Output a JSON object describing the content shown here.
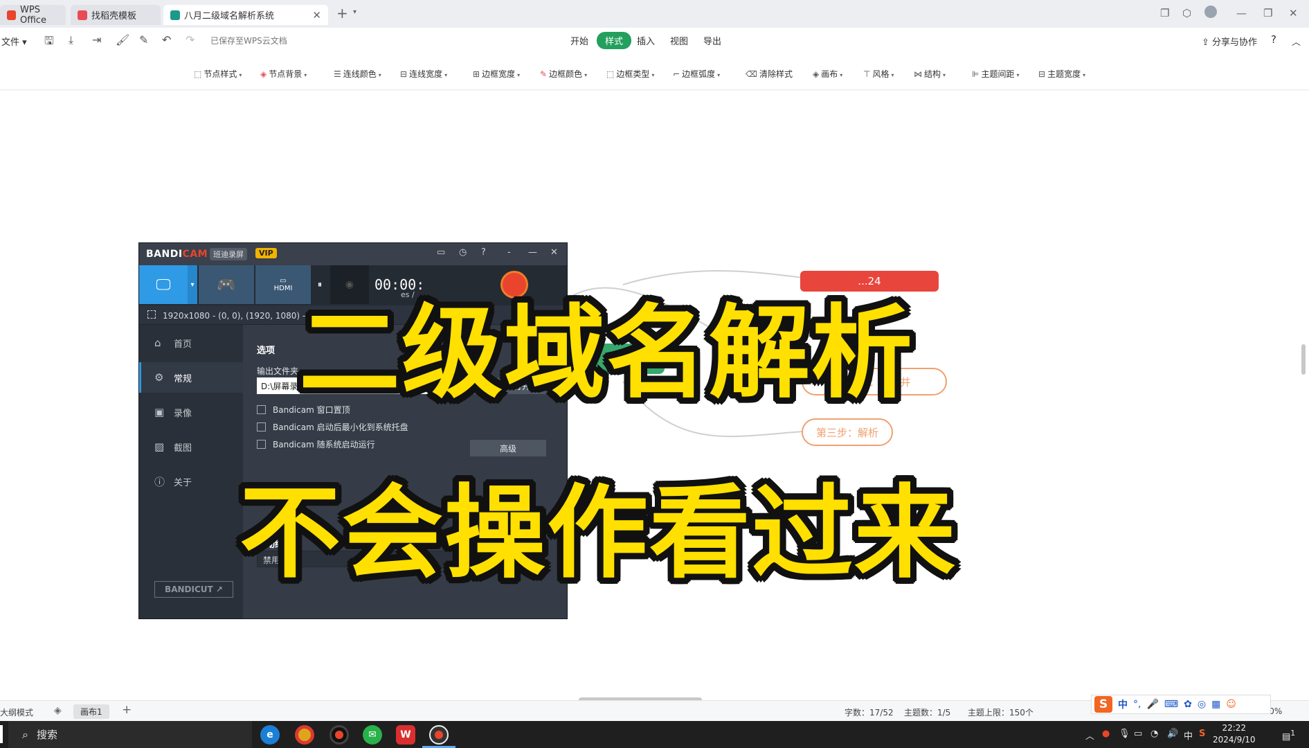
{
  "titlebar": {
    "tabs": [
      {
        "label": "WPS Office",
        "active": false
      },
      {
        "label": "找稻壳模板",
        "active": false
      },
      {
        "label": "八月二级域名解析系统",
        "active": true
      }
    ],
    "new_tab": "+",
    "window_controls": [
      "minimize",
      "restore",
      "close"
    ]
  },
  "menubar": {
    "file_label": "文件",
    "saved_status": "已保存至WPS云文档",
    "tabs": [
      "开始",
      "样式",
      "插入",
      "视图",
      "导出"
    ],
    "active_tab": "样式",
    "share_label": "分享与协作",
    "help": "?"
  },
  "stylebar": {
    "items": [
      "节点样式",
      "节点背景",
      "连线颜色",
      "连线宽度",
      "边框宽度",
      "边框颜色",
      "边框类型",
      "边框弧度",
      "清除样式",
      "画布",
      "风格",
      "结构",
      "主题间距",
      "主题宽度"
    ]
  },
  "mindmap": {
    "nodes": [
      {
        "label": "第二步：选择并",
        "color": "#f0a070"
      },
      {
        "label": "第三步：解析",
        "color": "#f0a070"
      }
    ],
    "partial_labels": [
      "...24",
      "口"
    ]
  },
  "bandicam": {
    "brand_a": "BANDI",
    "brand_b": "CAM",
    "brand_cn": "班迪录屏",
    "vip": "VIP",
    "timer": "00:00:",
    "size_text": "es /",
    "hdmi": "HDMI",
    "region": "1920x1080 - (0, 0), (1920, 1080) - 显示器 1",
    "nav": [
      {
        "label": "首页",
        "icon": "home-icon"
      },
      {
        "label": "常规",
        "icon": "gear-icon"
      },
      {
        "label": "录像",
        "icon": "video-icon"
      },
      {
        "label": "截图",
        "icon": "image-icon"
      },
      {
        "label": "关于",
        "icon": "info-icon"
      }
    ],
    "active_nav": "常规",
    "bandicut": "BANDICUT",
    "section_options": "选项",
    "output_folder_label": "输出文件夹",
    "output_path": "D:\\屏幕录制\\视频",
    "browse_btn": "...",
    "open_btn": "打开",
    "checks": [
      {
        "label": "Bandicam 窗口置顶",
        "checked": false
      },
      {
        "label": "Bandicam 启动后最小化到系统托盘",
        "checked": false
      },
      {
        "label": "Bandicam 随系统启动运行",
        "checked": false
      }
    ],
    "advanced_btn": "高级",
    "timer_section": "定时录",
    "auto_section": "自动结",
    "auto_value": "禁用",
    "settings_btn": "设置"
  },
  "overlay": {
    "line1": "二级域名解析",
    "line2": "不会操作看过来"
  },
  "statusbar": {
    "outline_mode": "大纲模式",
    "canvas_tab": "画布1",
    "add": "+",
    "word_count": "字数：17/52",
    "topic_count": "主题数：1/5",
    "topic_limit": "主题上限：150个",
    "zoom": "100%"
  },
  "ime": {
    "logo": "S",
    "lang": "中"
  },
  "taskbar": {
    "search_placeholder": "搜索",
    "ime_lang": "中",
    "time": "22:22",
    "date": "2024/9/10",
    "notification_count": "1"
  },
  "colors": {
    "wps_green": "#23a05d",
    "bandicam_blue": "#2f9ae6",
    "bandicam_red": "#e8452c",
    "overlay_yellow": "#ffe000"
  }
}
